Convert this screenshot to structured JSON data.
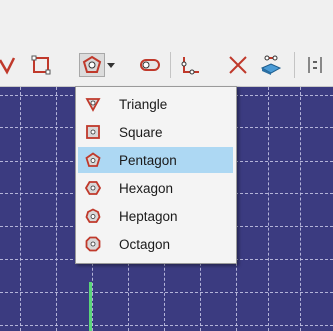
{
  "toolbar": {
    "buttons": [
      {
        "icon": "polyline-icon"
      },
      {
        "icon": "rectangle-icon"
      },
      {
        "icon": "regular-polygon-icon"
      },
      {
        "icon": "dropdown-arrow-icon"
      },
      {
        "icon": "slot-icon"
      },
      {
        "icon": "fillet-icon"
      },
      {
        "icon": "trim-icon"
      },
      {
        "icon": "external-geometry-icon"
      },
      {
        "icon": "constraint-icon"
      }
    ]
  },
  "polygon_menu": {
    "items": [
      {
        "label": "Triangle",
        "icon": "triangle-icon"
      },
      {
        "label": "Square",
        "icon": "square-icon"
      },
      {
        "label": "Pentagon",
        "icon": "pentagon-icon",
        "selected": true
      },
      {
        "label": "Hexagon",
        "icon": "hexagon-icon"
      },
      {
        "label": "Heptagon",
        "icon": "heptagon-icon"
      },
      {
        "label": "Octagon",
        "icon": "octagon-icon"
      }
    ]
  },
  "colors": {
    "viewport_bg": "#3b3b80",
    "menu_highlight": "#add8f3",
    "axis_green": "#5bd67a"
  }
}
